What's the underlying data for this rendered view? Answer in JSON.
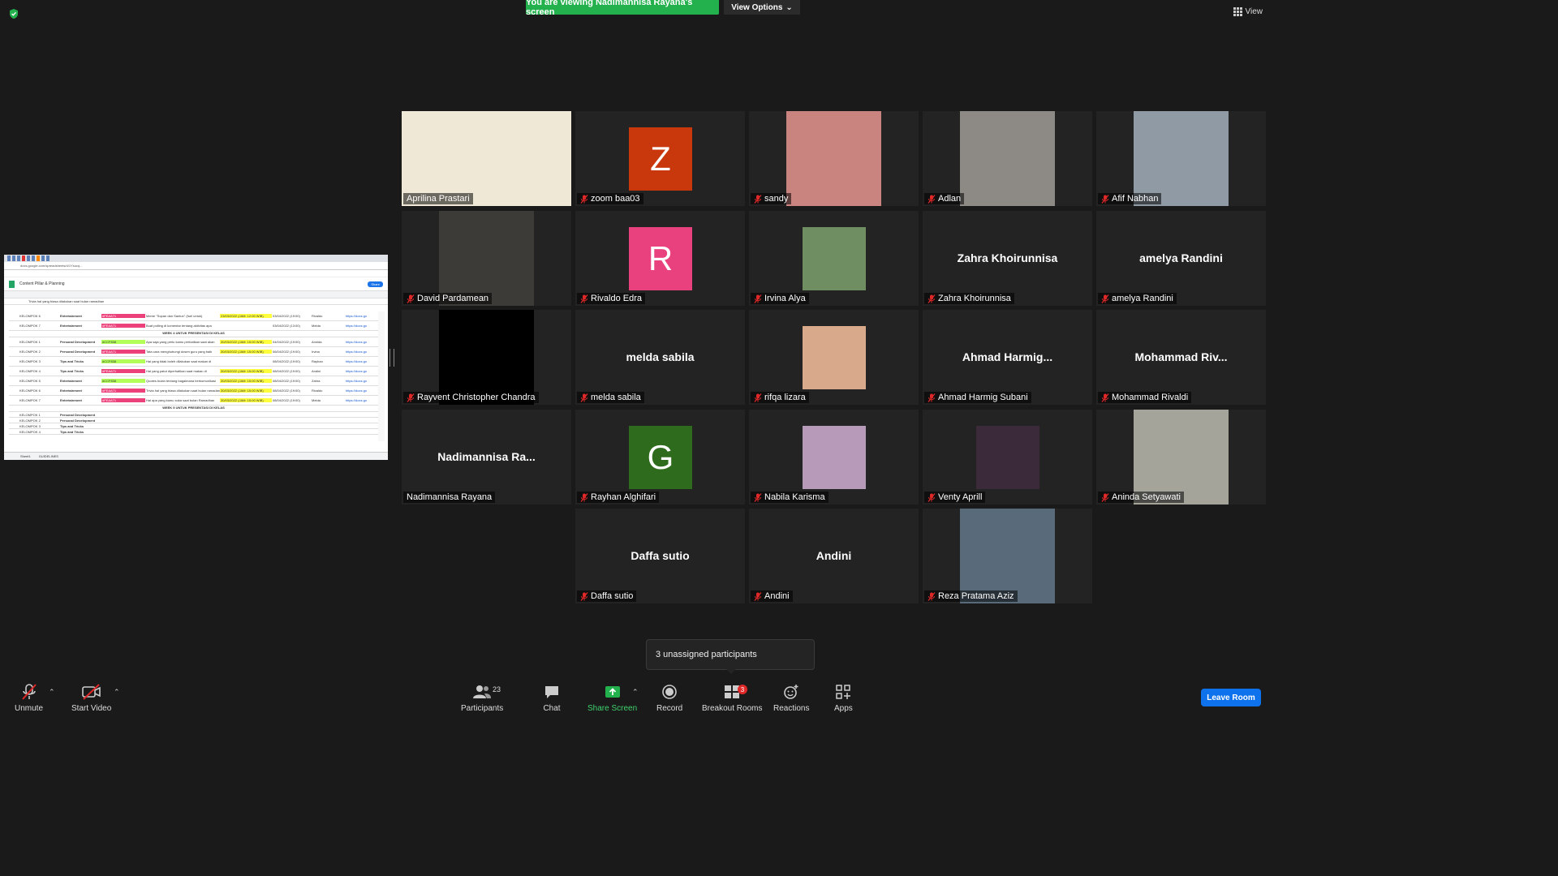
{
  "banner": {
    "text": "You are viewing Nadimannisa Rayana's screen"
  },
  "view_options": {
    "label": "View Options"
  },
  "view_button": {
    "label": "View"
  },
  "shared_screen": {
    "doc_title": "Content Pillar & Planning",
    "url": "docs.google.com/spreadsheets/d/1Ysucq...",
    "share_label": "Share",
    "formula": "Trivia hal yang biasa dilakukan saat bulan ramadhan",
    "week4_label": "WEEK 4 UNTUK PRESENTASI DI KELAS",
    "week5_label": "WEEK 5 UNTUK PRESENTASI DI KELAS",
    "sheet_tab": "Sheet1",
    "sheet_tab2": "GUIDELINES",
    "rows": [
      [
        "KELOMPOK 6",
        "Entertainment",
        "#FEAA71",
        "Meme \"Sopan dan Santun\" (fuel untuk)",
        "23/03/2022 (JAM: 12:00 WIB)",
        "03/04/2022 (19:00)",
        "Rivaldo",
        "https://docs.go"
      ],
      [
        "KELOMPOK 7",
        "Entertainment",
        "#FEAA71",
        "Buat polling di komentar tentang aktivitas apa",
        "",
        "03/04/2022 (13:00)",
        "Melda",
        "https://docs.go"
      ],
      [
        "KELOMPOK 1",
        "Personal Development",
        "#CCF838",
        "Apa saja yang perlu kamu perhatikan saat akan",
        "30/03/2022 (JAM: 15:00 WIB)",
        "04/04/2022 (19:00)",
        "Annida",
        "https://docs.go"
      ],
      [
        "KELOMPOK 2",
        "Personal Development",
        "#FEAA71",
        "Tata cara menghubungi dosen guru yang baik",
        "30/03/2022 (JAM: 15:00 WIB)",
        "06/04/2022 (19:00)",
        "Irvina",
        "https://docs.go"
      ],
      [
        "KELOMPOK 3",
        "Tips and Tricks",
        "#CCF838",
        "Hal yang tidak boleh dilakukan saat makan di",
        "",
        "08/04/2022 (19:00)",
        "Rayhan",
        "https://docs.go"
      ],
      [
        "KELOMPOK 4",
        "Tips and Tricks",
        "#FEAA71",
        "Hal yang patut diperhatikan saat makan di",
        "30/03/2022 (JAM: 15:00 WIB)",
        "08/04/2022 (19:00)",
        "Andini",
        "https://docs.go"
      ],
      [
        "KELOMPOK 5",
        "Entertainment",
        "#CCF838",
        "Quotes bulan tentang bagaimana berkomunikasi",
        "30/03/2022 (JAM: 15:00 WIB)",
        "08/04/2022 (19:00)",
        "Zahra",
        "https://docs.go"
      ],
      [
        "KELOMPOK 6",
        "Entertainment",
        "#FEAA71",
        "Trivia hal yang biasa dilakukan saat bulan ramadan",
        "30/03/2022 (JAM: 15:00 WIB)",
        "08/04/2022 (19:00)",
        "Rivaldo",
        "https://docs.go"
      ],
      [
        "KELOMPOK 7",
        "Entertainment",
        "#FEAA71",
        "Hal apa yang kamu suka saat bulan Ramadhan",
        "30/03/2022 (JAM: 15:00 WIB)",
        "08/04/2022 (19:00)",
        "Melda",
        "https://docs.go"
      ]
    ],
    "empty_rows": [
      [
        "KELOMPOK 1",
        "Personal Development"
      ],
      [
        "KELOMPOK 2",
        "Personal Development"
      ],
      [
        "KELOMPOK 3",
        "Tips and Tricks"
      ],
      [
        "KELOMPOK 4",
        "Tips and Tricks"
      ]
    ]
  },
  "participants": [
    {
      "name": "Aprilina Prastari",
      "type": "photo",
      "muted": false,
      "active": true,
      "color": "#efe8d6"
    },
    {
      "name": "zoom baa03",
      "type": "initial",
      "initial": "Z",
      "color": "#c8380c",
      "muted": true
    },
    {
      "name": "sandy",
      "type": "photo",
      "color": "#c9847f",
      "muted": true
    },
    {
      "name": "Adlan",
      "type": "photo",
      "color": "#8d8a86",
      "muted": true
    },
    {
      "name": "Afif Nabhan",
      "type": "photo",
      "color": "#8f9aa5",
      "muted": true
    },
    {
      "name": "David Pardamean",
      "type": "photo",
      "color": "#3c3b37",
      "muted": true
    },
    {
      "name": "Rivaldo Edra",
      "type": "initial",
      "initial": "R",
      "color": "#e8417e",
      "muted": true
    },
    {
      "name": "Irvina Alya",
      "type": "photo-small",
      "color": "#6f8f63",
      "muted": true
    },
    {
      "name": "Zahra Khoirunnisa",
      "type": "name",
      "display": "Zahra Khoirunnisa",
      "muted": true
    },
    {
      "name": "amelya Randini",
      "type": "name",
      "display": "amelya Randini",
      "muted": true
    },
    {
      "name": "Rayvent Christopher Chandra",
      "type": "photo",
      "color": "#000000",
      "muted": true
    },
    {
      "name": "melda sabila",
      "type": "name",
      "display": "melda sabila",
      "muted": true
    },
    {
      "name": "rifqa lizara",
      "type": "photo-small",
      "color": "#d9a98c",
      "muted": true
    },
    {
      "name": "Ahmad Harmig Subani",
      "type": "name",
      "display": "Ahmad  Harmig...",
      "muted": true
    },
    {
      "name": "Mohammad Rivaldi",
      "type": "name",
      "display": "Mohammad  Riv...",
      "muted": true
    },
    {
      "name": "Nadimannisa Rayana",
      "type": "name",
      "display": "Nadimannisa  Ra...",
      "muted": false
    },
    {
      "name": "Rayhan Alghifari",
      "type": "initial",
      "initial": "G",
      "color": "#2e6b1c",
      "muted": true
    },
    {
      "name": "Nabila Karisma",
      "type": "photo-small",
      "color": "#b79ab9",
      "muted": true
    },
    {
      "name": "Venty Aprill",
      "type": "photo-small",
      "color": "#3b2a3a",
      "muted": true
    },
    {
      "name": "Aninda Setyawati",
      "type": "photo",
      "color": "#a5a49b",
      "muted": true
    },
    {
      "name": "Daffa sutio",
      "type": "name",
      "display": "Daffa sutio",
      "muted": true
    },
    {
      "name": "Andini",
      "type": "name",
      "display": "Andini",
      "muted": true
    },
    {
      "name": "Reza Pratama Aziz",
      "type": "photo",
      "color": "#596a7a",
      "muted": true
    }
  ],
  "popup": {
    "text": "3 unassigned participants"
  },
  "toolbar": {
    "unmute": "Unmute",
    "start_video": "Start Video",
    "participants": "Participants",
    "participants_count": "23",
    "chat": "Chat",
    "share_screen": "Share Screen",
    "record": "Record",
    "breakout_rooms": "Breakout Rooms",
    "breakout_badge": "3",
    "reactions": "Reactions",
    "apps": "Apps",
    "leave": "Leave Room"
  },
  "colors": {
    "accent_green": "#23b14d",
    "active_border": "#f2e600",
    "leave_blue": "#0e72ed"
  }
}
